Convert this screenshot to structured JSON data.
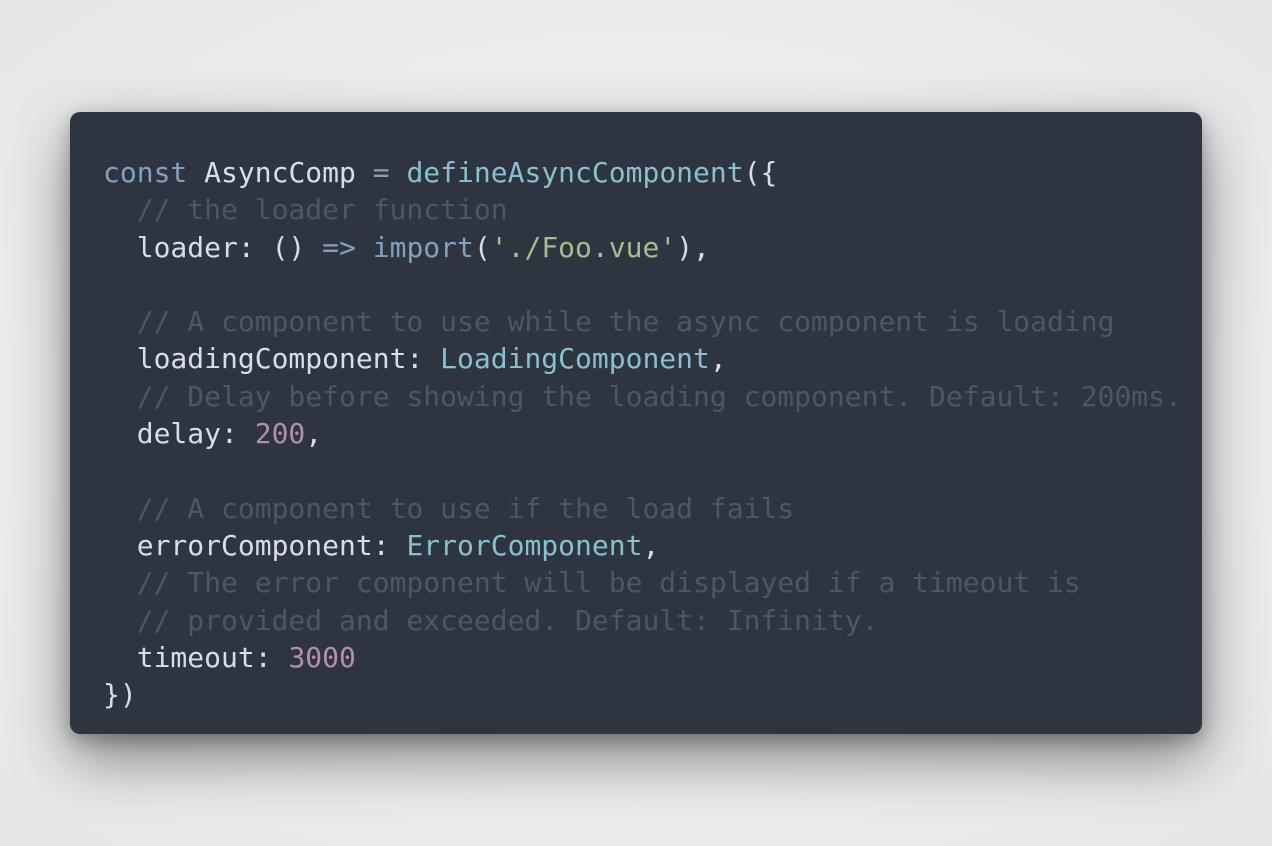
{
  "colors": {
    "page_background": "#ececec",
    "editor_background": "#2e3440",
    "default_text": "#d8dee9",
    "keyword": "#81a1c1",
    "function": "#88c0d0",
    "string": "#a3be8c",
    "number": "#b48ead",
    "comment": "#4c566a",
    "operator": "#81a1c1"
  },
  "code": {
    "lines": [
      [
        {
          "t": "const",
          "c": "keyword"
        },
        {
          "t": " AsyncComp ",
          "c": "default_text"
        },
        {
          "t": "=",
          "c": "operator"
        },
        {
          "t": " ",
          "c": "default_text"
        },
        {
          "t": "defineAsyncComponent",
          "c": "function"
        },
        {
          "t": "({",
          "c": "default_text"
        }
      ],
      [
        {
          "t": "  // the loader function",
          "c": "comment"
        }
      ],
      [
        {
          "t": "  loader: () ",
          "c": "default_text"
        },
        {
          "t": "=>",
          "c": "operator"
        },
        {
          "t": " ",
          "c": "default_text"
        },
        {
          "t": "import",
          "c": "keyword"
        },
        {
          "t": "(",
          "c": "default_text"
        },
        {
          "t": "'./Foo.vue'",
          "c": "string"
        },
        {
          "t": "),",
          "c": "default_text"
        }
      ],
      [],
      [
        {
          "t": "  // A component to use while the async component is loading",
          "c": "comment"
        }
      ],
      [
        {
          "t": "  loadingComponent: ",
          "c": "default_text"
        },
        {
          "t": "LoadingComponent",
          "c": "function"
        },
        {
          "t": ",",
          "c": "default_text"
        }
      ],
      [
        {
          "t": "  // Delay before showing the loading component. Default: 200ms.",
          "c": "comment"
        }
      ],
      [
        {
          "t": "  delay: ",
          "c": "default_text"
        },
        {
          "t": "200",
          "c": "number"
        },
        {
          "t": ",",
          "c": "default_text"
        }
      ],
      [],
      [
        {
          "t": "  // A component to use if the load fails",
          "c": "comment"
        }
      ],
      [
        {
          "t": "  errorComponent: ",
          "c": "default_text"
        },
        {
          "t": "ErrorComponent",
          "c": "function"
        },
        {
          "t": ",",
          "c": "default_text"
        }
      ],
      [
        {
          "t": "  // The error component will be displayed if a timeout is",
          "c": "comment"
        }
      ],
      [
        {
          "t": "  // provided and exceeded. Default: Infinity.",
          "c": "comment"
        }
      ],
      [
        {
          "t": "  timeout: ",
          "c": "default_text"
        },
        {
          "t": "3000",
          "c": "number"
        }
      ],
      [
        {
          "t": "})",
          "c": "default_text"
        }
      ]
    ]
  }
}
